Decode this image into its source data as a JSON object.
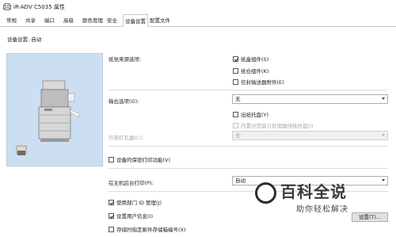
{
  "window": {
    "title": "iR-ADV C5035 属性"
  },
  "tabs": [
    {
      "label": "常规"
    },
    {
      "label": "共享"
    },
    {
      "label": "端口"
    },
    {
      "label": "高级"
    },
    {
      "label": "颜色管理"
    },
    {
      "label": "安全"
    },
    {
      "label": "设备设置"
    },
    {
      "label": "配置文件"
    }
  ],
  "active_tab": "设备设置",
  "header": {
    "device_setting_label": "设备设置: 自动"
  },
  "paper_source": {
    "label": "纸张来源选项:",
    "options": [
      {
        "label": "纸盒组件(S)",
        "checked": true
      },
      {
        "label": "纸仓组件(K)",
        "checked": false
      },
      {
        "label": "信封输送器附件(E)",
        "checked": false
      }
    ]
  },
  "output": {
    "label": "输出选项(O):",
    "value": "无",
    "options": [
      {
        "label": "出纸托盘(Y)",
        "checked": false,
        "disabled": false
      },
      {
        "label": "内置分页装订处理器排纸托盘(I)",
        "checked": false,
        "disabled": true
      }
    ]
  },
  "punch": {
    "label": "外部打孔器(C):",
    "value": "无",
    "disabled": true
  },
  "secure_print": {
    "label": "设备的保密打印功能(V)",
    "checked": false
  },
  "host_spool": {
    "label": "在主机后台打印(P):",
    "value": "自动"
  },
  "department": {
    "label": "使用部门 ID 管理(J)",
    "checked": true
  },
  "user_info": {
    "label": "设置用户信息(I)",
    "checked": true
  },
  "store_box": {
    "label": "存储时指定邮件存储箱编号(X)",
    "checked": false
  },
  "settings_button": {
    "label": "设置(T)..."
  },
  "watermark": {
    "title": "百科全说",
    "subtitle": "助你轻松解决"
  },
  "colors": {
    "preview_bg": "#ccdff2",
    "accent": "#0078d7"
  }
}
